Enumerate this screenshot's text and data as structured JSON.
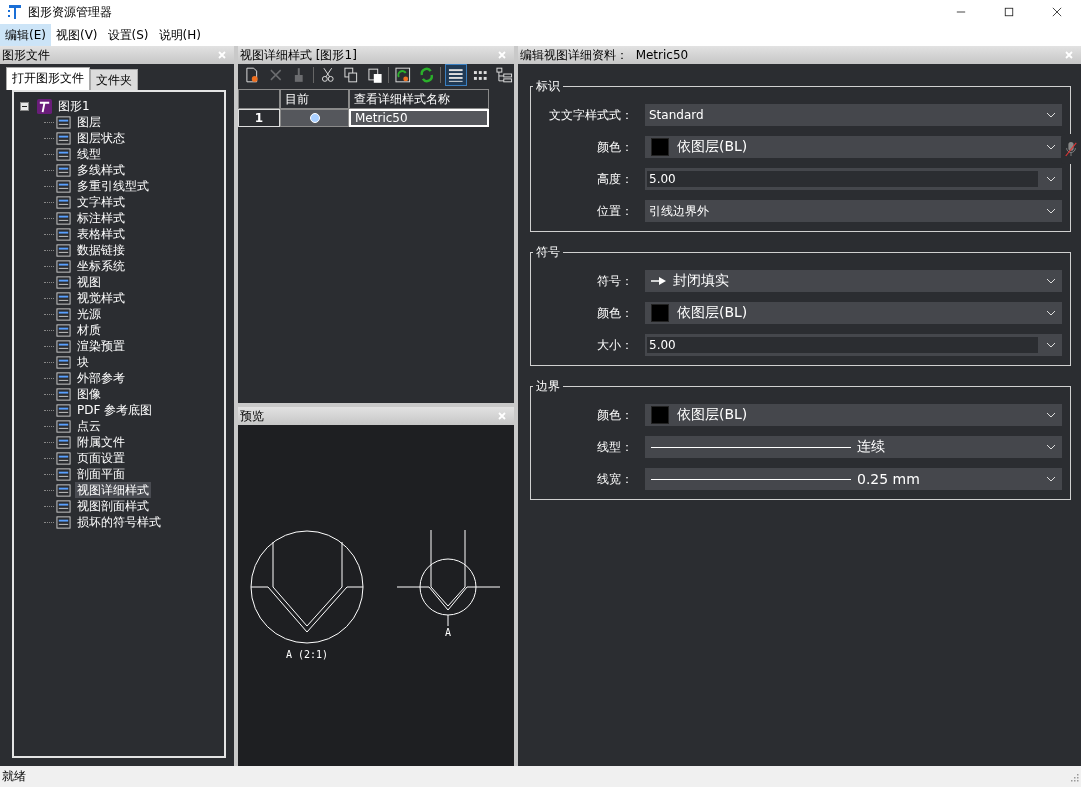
{
  "window": {
    "title": "图形资源管理器"
  },
  "menu": [
    {
      "label": "编辑(E)",
      "selected": true
    },
    {
      "label": "视图(V)",
      "selected": false
    },
    {
      "label": "设置(S)",
      "selected": false
    },
    {
      "label": "说明(H)",
      "selected": false
    }
  ],
  "left_panel": {
    "title": "图形文件",
    "tabs": [
      {
        "label": "打开图形文件",
        "selected": true
      },
      {
        "label": "文件夹",
        "selected": false
      }
    ],
    "tree": [
      {
        "label": "图形1",
        "expanded": true,
        "selected": false,
        "children": [
          {
            "label": "图层",
            "selected": false
          },
          {
            "label": "图层状态",
            "selected": false
          },
          {
            "label": "线型",
            "selected": false
          },
          {
            "label": "多线样式",
            "selected": false
          },
          {
            "label": "多重引线型式",
            "selected": false
          },
          {
            "label": "文字样式",
            "selected": false
          },
          {
            "label": "标注样式",
            "selected": false
          },
          {
            "label": "表格样式",
            "selected": false
          },
          {
            "label": "数据链接",
            "selected": false
          },
          {
            "label": "坐标系统",
            "selected": false
          },
          {
            "label": "视图",
            "selected": false
          },
          {
            "label": "视觉样式",
            "selected": false
          },
          {
            "label": "光源",
            "selected": false
          },
          {
            "label": "材质",
            "selected": false
          },
          {
            "label": "渲染预置",
            "selected": false
          },
          {
            "label": "块",
            "selected": false
          },
          {
            "label": "外部参考",
            "selected": false
          },
          {
            "label": "图像",
            "selected": false
          },
          {
            "label": "PDF 参考底图",
            "selected": false
          },
          {
            "label": "点云",
            "selected": false
          },
          {
            "label": "附属文件",
            "selected": false
          },
          {
            "label": "页面设置",
            "selected": false
          },
          {
            "label": "剖面平面",
            "selected": false
          },
          {
            "label": "视图详细样式",
            "selected": true
          },
          {
            "label": "视图剖面样式",
            "selected": false
          },
          {
            "label": "损坏的符号样式",
            "selected": false
          }
        ]
      }
    ]
  },
  "style_panel": {
    "title": "视图详细样式 [图形1]",
    "toolbar": [
      {
        "kind": "new",
        "disabled": false,
        "selected": false
      },
      {
        "kind": "delete",
        "disabled": true,
        "selected": false
      },
      {
        "kind": "brush",
        "disabled": true,
        "selected": false
      },
      {
        "kind": "cut",
        "disabled": false,
        "selected": false
      },
      {
        "kind": "copy",
        "disabled": false,
        "selected": false
      },
      {
        "kind": "paste",
        "disabled": false,
        "selected": false
      },
      {
        "kind": "import",
        "disabled": false,
        "selected": false
      },
      {
        "kind": "refresh",
        "disabled": false,
        "selected": false
      },
      {
        "kind": "list",
        "disabled": false,
        "selected": true
      },
      {
        "kind": "icons",
        "disabled": false,
        "selected": false
      },
      {
        "kind": "tree",
        "disabled": false,
        "selected": false
      }
    ],
    "table": {
      "columns": [
        "目前",
        "查看详细样式名称"
      ],
      "rows": [
        {
          "number": "1",
          "current": true,
          "name": "Metric50",
          "selected": true
        }
      ]
    }
  },
  "preview_panel": {
    "title": "预览",
    "labels": [
      "A (2:1)",
      "A"
    ]
  },
  "detail_panel": {
    "title": "编辑视图详细资料：",
    "style_name": "Metric50",
    "groups": [
      {
        "title": "标识",
        "fields": [
          {
            "kind": "select",
            "label": "文文字样式式：",
            "value": "Standard"
          },
          {
            "kind": "color",
            "label": "颜色：",
            "value": "依图层(BL)",
            "color": "#000000"
          },
          {
            "kind": "number",
            "label": "高度：",
            "value": "5.00"
          },
          {
            "kind": "select",
            "label": "位置：",
            "value": "引线边界外"
          }
        ]
      },
      {
        "title": "符号",
        "fields": [
          {
            "kind": "symbol",
            "label": "符号：",
            "value": "封闭填实"
          },
          {
            "kind": "color",
            "label": "颜色：",
            "value": "依图层(BL)",
            "color": "#000000"
          },
          {
            "kind": "number",
            "label": "大小：",
            "value": "5.00"
          }
        ]
      },
      {
        "title": "边界",
        "fields": [
          {
            "kind": "color",
            "label": "颜色：",
            "value": "依图层(BL)",
            "color": "#000000"
          },
          {
            "kind": "line",
            "label": "线型：",
            "value": "连续"
          },
          {
            "kind": "line",
            "label": "线宽：",
            "value": "0.25 mm"
          }
        ]
      }
    ]
  },
  "status_bar": {
    "text": "就绪"
  }
}
